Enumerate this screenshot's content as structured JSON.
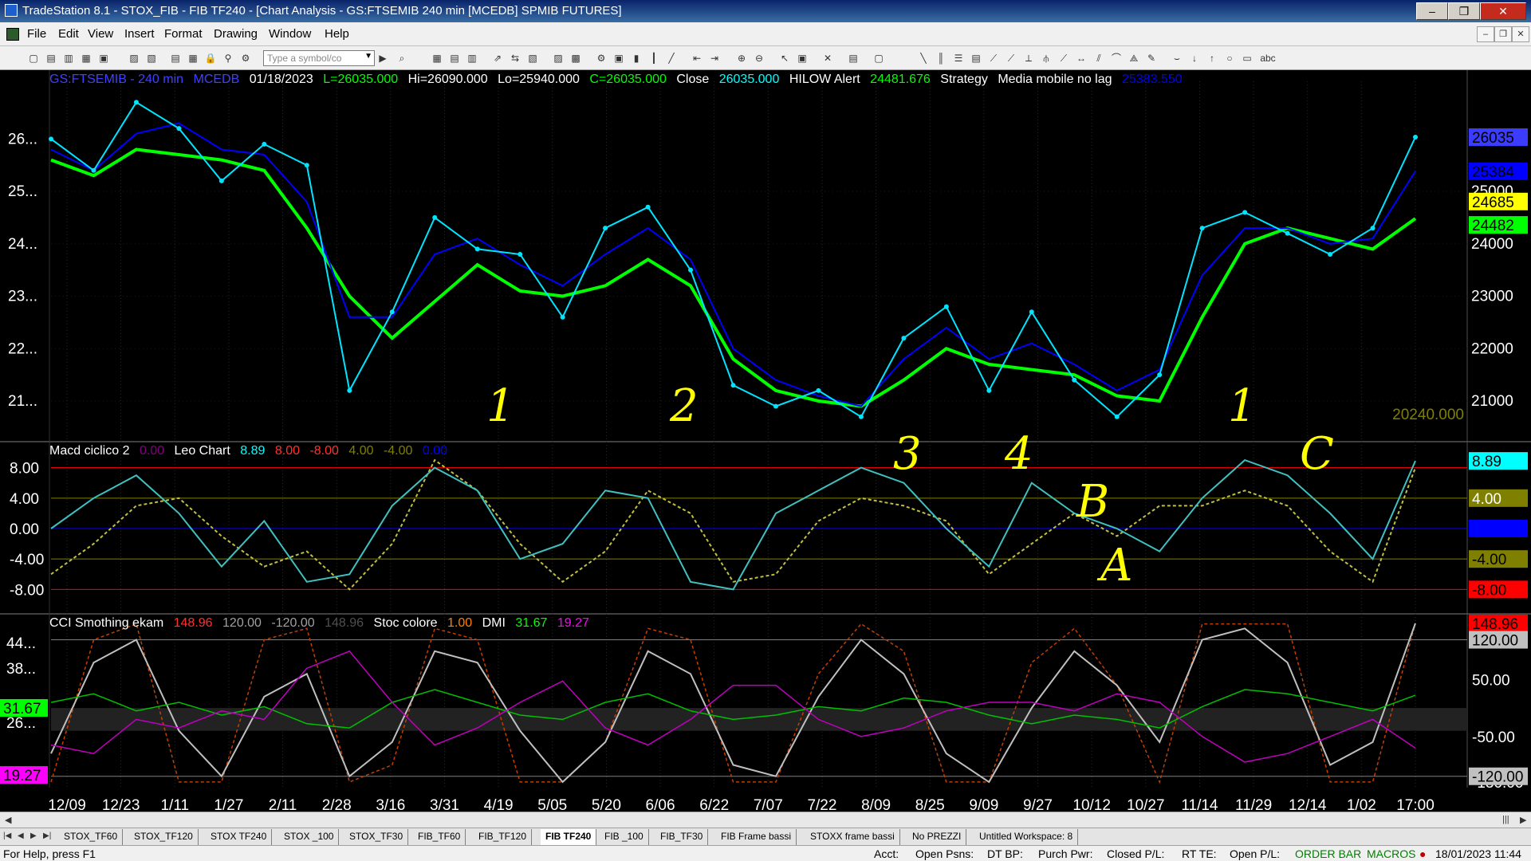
{
  "window": {
    "title": "TradeStation 8.1 - STOX_FIB - FIB TF240 - [Chart Analysis - GS:FTSEMIB  240 min  [MCEDB] SPMIB FUTURES]",
    "minimize": "–",
    "restore": "❐",
    "close": "✕"
  },
  "menu": {
    "items": [
      "File",
      "Edit",
      "View",
      "Insert",
      "Format",
      "Drawing",
      "Window",
      "Help"
    ],
    "mdi_minimize": "–",
    "mdi_restore": "❐",
    "mdi_close": "✕"
  },
  "toolbar": {
    "symbol_placeholder": "Type a symbol/co",
    "abc_label": "abc"
  },
  "price_header": {
    "symbol": "GS:FTSEMIB - 240 min",
    "source": "MCEDB",
    "date": "01/18/2023",
    "last": "L=26035.000",
    "high": "Hi=26090.000",
    "low": "Lo=25940.000",
    "close": "C=26035.000",
    "close_label": "Close",
    "close_value": "26035.000",
    "hilow_label": "HILOW Alert",
    "hilow_value": "24481.676",
    "strategy_label": "Strategy",
    "media_label": "Media mobile no lag",
    "media_value": "25383.550"
  },
  "macd_header": {
    "name": "Macd ciclico 2",
    "v1": "0.00",
    "leo_label": "Leo Chart",
    "v2": "8.89",
    "v3": "8.00",
    "v4": "-8.00",
    "v5": "4.00",
    "v6": "-4.00",
    "v7": "0.00"
  },
  "cci_header": {
    "name": "CCI Smothing ekam",
    "v1": "148.96",
    "v2": "120.00",
    "v3": "-120.00",
    "v4": "148.96",
    "stoc_label": "Stoc colore",
    "v5": "1.00",
    "dmi_label": "DMI",
    "v6": "31.67",
    "v7": "19.27"
  },
  "chart_data": [
    {
      "type": "line",
      "title": "GS:FTSEMIB - 240 min",
      "price_axis_ticks": [
        "25000",
        "24000",
        "23000",
        "22000",
        "21000"
      ],
      "left_axis_ticks": [
        "26...",
        "25...",
        "24...",
        "23...",
        "22...",
        "21..."
      ],
      "x_ticks": [
        "12/09",
        "12/23",
        "1/11",
        "1/27",
        "2/11",
        "2/28",
        "3/16",
        "3/31",
        "4/19",
        "5/05",
        "5/20",
        "6/06",
        "6/22",
        "7/07",
        "7/22",
        "8/09",
        "8/25",
        "9/09",
        "9/27",
        "10/12",
        "10/27",
        "11/14",
        "11/29",
        "12/14",
        "1/02",
        "17:00"
      ],
      "price_labels": [
        {
          "value": "26035",
          "color": "#3c3cff"
        },
        {
          "value": "25384",
          "color": "#0000ff"
        },
        {
          "value": "24685",
          "color": "#ffff00"
        },
        {
          "value": "24482",
          "color": "#00ff00"
        }
      ],
      "low_marker": "20240.000",
      "series": [
        {
          "name": "Close",
          "color": "#00e5ff",
          "values": [
            26000,
            25400,
            26700,
            26200,
            25200,
            25900,
            25500,
            21200,
            22700,
            24500,
            23900,
            23800,
            22600,
            24300,
            24700,
            23500,
            21300,
            20900,
            21200,
            20700,
            22200,
            22800,
            21200,
            22700,
            21400,
            20700,
            21500,
            24300,
            24600,
            24200,
            23800,
            24300,
            26035
          ]
        },
        {
          "name": "Media mobile no lag",
          "color": "#0000ff",
          "values": [
            25800,
            25400,
            26100,
            26300,
            25800,
            25700,
            24800,
            22600,
            22600,
            23800,
            24100,
            23600,
            23200,
            23800,
            24300,
            23700,
            22000,
            21400,
            21100,
            20900,
            21800,
            22400,
            21800,
            22100,
            21700,
            21200,
            21600,
            23400,
            24300,
            24300,
            24000,
            24100,
            25384
          ]
        },
        {
          "name": "HILOW Alert",
          "color": "#00ff00",
          "values": [
            25600,
            25300,
            25800,
            25700,
            25600,
            25400,
            24300,
            23000,
            22200,
            22900,
            23600,
            23100,
            23000,
            23200,
            23700,
            23200,
            21800,
            21200,
            21000,
            20900,
            21400,
            22000,
            21700,
            21600,
            21500,
            21100,
            21000,
            22600,
            24000,
            24300,
            24100,
            23900,
            24482
          ]
        }
      ]
    },
    {
      "type": "line",
      "title": "Macd ciclico 2",
      "y_ticks": [
        "8.00",
        "4.00",
        "0.00",
        "-4.00",
        "-8.00"
      ],
      "right_labels": [
        {
          "value": "8.89",
          "bg": "#00ffff",
          "fg": "#000000"
        },
        {
          "value": "4.00",
          "bg": "#808000",
          "fg": "#ffffff"
        },
        {
          "value": "0.00",
          "bg": "#0000ff",
          "fg": "#0000ff"
        },
        {
          "value": "-4.00",
          "bg": "#808000",
          "fg": "#000000"
        },
        {
          "value": "-8.00",
          "bg": "#ff0000",
          "fg": "#000000"
        }
      ],
      "series": [
        {
          "name": "Leo Chart",
          "color": "#40c0c0",
          "values": [
            0,
            4,
            7,
            2,
            -5,
            1,
            -7,
            -6,
            3,
            8,
            5,
            -4,
            -2,
            5,
            4,
            -7,
            -8,
            2,
            5,
            8,
            6,
            0,
            -5,
            6,
            2,
            0,
            -3,
            4,
            9,
            7,
            2,
            -4,
            8.89
          ]
        },
        {
          "name": "Macd ciclico 2",
          "color": "#c0c040",
          "values": [
            -6,
            -2,
            3,
            4,
            -1,
            -5,
            -3,
            -8,
            -2,
            9,
            5,
            -2,
            -7,
            -3,
            5,
            2,
            -7,
            -6,
            1,
            4,
            3,
            1,
            -6,
            -2,
            2,
            -1,
            3,
            3,
            5,
            3,
            -3,
            -7,
            8
          ]
        }
      ]
    },
    {
      "type": "line",
      "title": "CCI Smothing ekam",
      "y_ticks": [
        "44...",
        "38...",
        "26..."
      ],
      "right_ticks": [
        "50.00",
        "-50.00",
        "-130.00"
      ],
      "right_labels": [
        {
          "value": "148.96",
          "bg": "#ff0000",
          "fg": "#000000"
        },
        {
          "value": "120.00",
          "bg": "#c0c0c0",
          "fg": "#000000"
        },
        {
          "value": "-120.00",
          "bg": "#c0c0c0",
          "fg": "#000000"
        }
      ],
      "left_labels": [
        {
          "value": "31.67",
          "bg": "#00ff00",
          "fg": "#000000"
        },
        {
          "value": "19.27",
          "bg": "#ff00ff",
          "fg": "#000000"
        }
      ],
      "series": [
        {
          "name": "CCI Smothing ekam",
          "color": "#c0c0c0",
          "values": [
            -80,
            80,
            120,
            -40,
            -120,
            20,
            60,
            -120,
            -60,
            100,
            80,
            -40,
            -130,
            -60,
            100,
            60,
            -100,
            -120,
            20,
            120,
            60,
            -80,
            -130,
            0,
            100,
            40,
            -60,
            120,
            140,
            80,
            -100,
            -60,
            148.96
          ]
        },
        {
          "name": "DMI +",
          "color": "#00c000",
          "values": [
            30,
            32,
            28,
            30,
            27,
            29,
            25,
            24,
            30,
            33,
            30,
            27,
            26,
            30,
            32,
            28,
            26,
            27,
            29,
            28,
            31,
            30,
            27,
            25,
            27,
            26,
            24,
            29,
            33,
            32,
            30,
            28,
            31.67
          ]
        },
        {
          "name": "DMI -",
          "color": "#c000c0",
          "values": [
            20,
            18,
            26,
            24,
            28,
            26,
            38,
            42,
            30,
            20,
            24,
            30,
            35,
            24,
            20,
            26,
            34,
            34,
            26,
            22,
            24,
            28,
            30,
            30,
            28,
            32,
            30,
            22,
            16,
            18,
            22,
            26,
            19.27
          ]
        },
        {
          "name": "Stoc colore",
          "color": "#c04000",
          "values": [
            -130,
            120,
            148,
            -130,
            -130,
            120,
            140,
            -130,
            -100,
            140,
            120,
            -130,
            -130,
            -60,
            140,
            120,
            -130,
            -130,
            60,
            148,
            100,
            -130,
            -130,
            80,
            140,
            40,
            -130,
            148,
            148,
            148,
            -130,
            -130,
            148.96
          ]
        }
      ]
    }
  ],
  "annotations": [
    "1",
    "2",
    "3",
    "4",
    "B",
    "A",
    "1",
    "C"
  ],
  "sheet_tabs": [
    "STOX_TF60",
    "STOX_TF120",
    "STOX TF240",
    "STOX _100",
    "STOX_TF30",
    "FIB_TF60",
    "FIB_TF120",
    "FIB TF240",
    "FIB _100",
    "FIB_TF30",
    "FIB Frame bassi",
    "STOXX frame bassi",
    "No PREZZI",
    "Untitled Workspace:  8"
  ],
  "active_tab": "FIB TF240",
  "status": {
    "help": "For Help, press F1",
    "acct": "Acct:",
    "open_psns": "Open Psns:",
    "dt_bp": "DT BP:",
    "purch_pwr": "Purch Pwr:",
    "closed_pl": "Closed P/L:",
    "rt_te": "RT TE:",
    "open_pl": "Open P/L:",
    "order_bar": "ORDER BAR",
    "macros": "MACROS",
    "datetime": "18/01/2023 11:44"
  }
}
